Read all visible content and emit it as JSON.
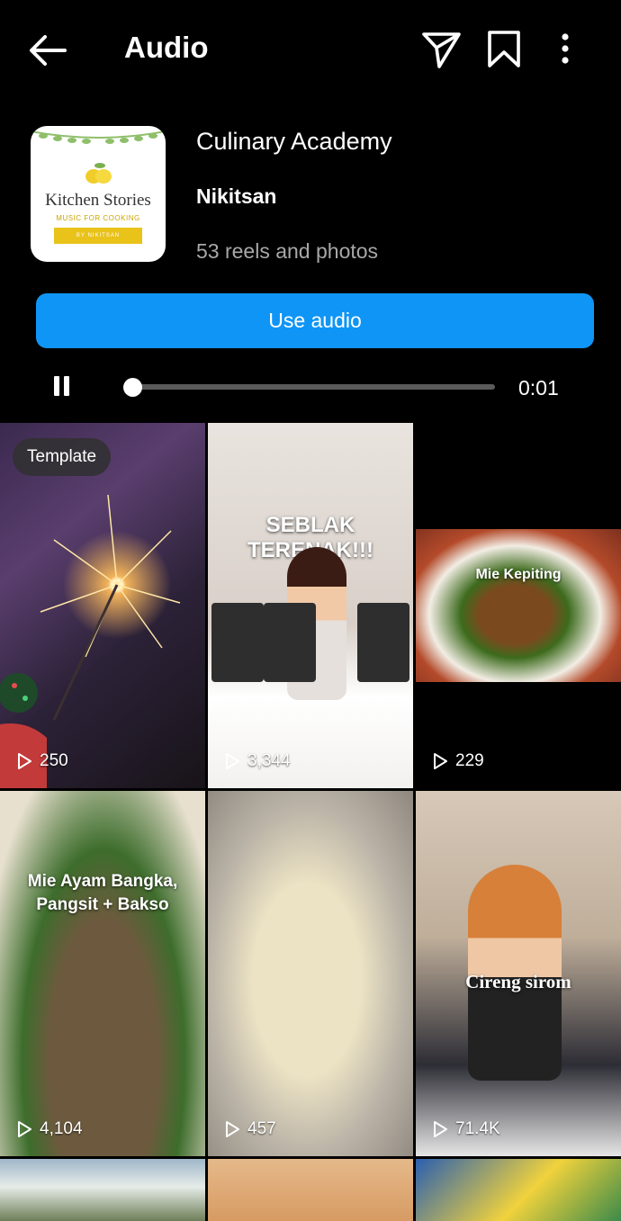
{
  "header": {
    "title": "Audio",
    "icons": [
      "back-arrow-icon",
      "send-icon",
      "bookmark-icon",
      "more-vertical-icon"
    ]
  },
  "audio": {
    "cover": {
      "title": "Kitchen Stories",
      "subtitle": "MUSIC FOR COOKING",
      "band": "BY NIKITSAN"
    },
    "track": "Culinary Academy",
    "artist": "Nikitsan",
    "count": "53 reels and photos",
    "use_label": "Use audio",
    "accent": "#0f95f6"
  },
  "player": {
    "time": "0:01",
    "progress": 0.02,
    "state": "playing"
  },
  "reels": [
    {
      "badge": "Template",
      "plays": "250"
    },
    {
      "caption": "SEBLAK TERENAK!!!",
      "plays": "3,344"
    },
    {
      "caption": "Mie Kepiting",
      "plays": "229"
    },
    {
      "caption": "Mie Ayam Bangka, Pangsit + Bakso",
      "plays": "4,104"
    },
    {
      "plays": "457"
    },
    {
      "caption": "Cireng sirom",
      "plays": "71.4K"
    }
  ]
}
